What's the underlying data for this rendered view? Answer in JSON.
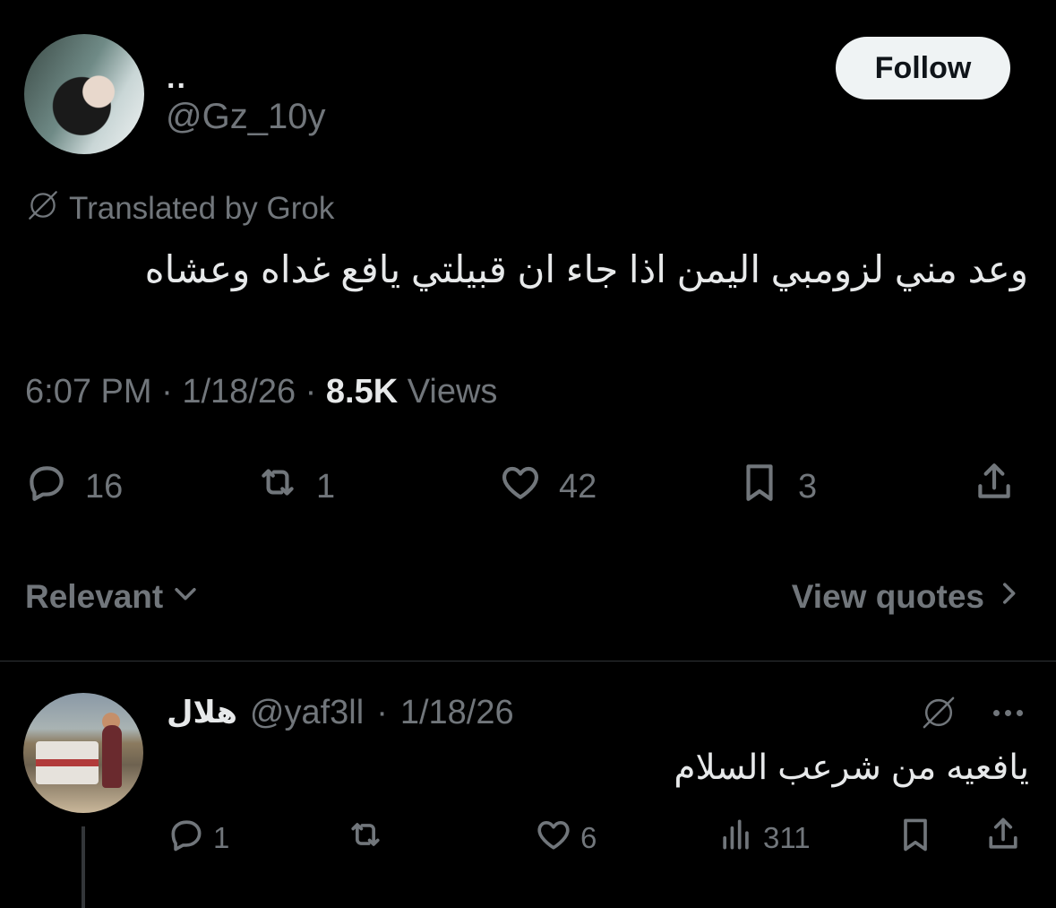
{
  "post": {
    "author": {
      "display_name": "..",
      "handle": "@Gz_10y"
    },
    "follow_label": "Follow",
    "translated_label": "Translated by Grok",
    "text": "وعد مني لزومبي اليمن اذا جاء ان قبيلتي يافع غداه وعشاه",
    "meta": {
      "time": "6:07 PM",
      "separator": " · ",
      "date": "1/18/26",
      "views_count": "8.5K",
      "views_label": " Views"
    },
    "actions": {
      "replies": "16",
      "reposts": "1",
      "likes": "42",
      "bookmarks": "3"
    }
  },
  "replies_bar": {
    "sort_label": "Relevant",
    "quotes_label": "View quotes"
  },
  "reply": {
    "display_name": "هلال",
    "handle": "@yaf3ll",
    "date_sep": "·",
    "date": "1/18/26",
    "text": "يافعيه من شرعب السلام",
    "actions": {
      "replies": "1",
      "reposts": "",
      "likes": "6",
      "views": "311"
    }
  },
  "colors": {
    "background": "#000000",
    "text_primary": "#e7e9ea",
    "text_secondary": "#71767b",
    "follow_button_bg": "#eff3f4",
    "divider": "#2f3336"
  },
  "icons": [
    "grok-icon",
    "reply-icon",
    "repost-icon",
    "like-icon",
    "bookmark-icon",
    "share-icon",
    "chevron-down-icon",
    "chevron-right-icon",
    "more-icon",
    "views-icon"
  ]
}
